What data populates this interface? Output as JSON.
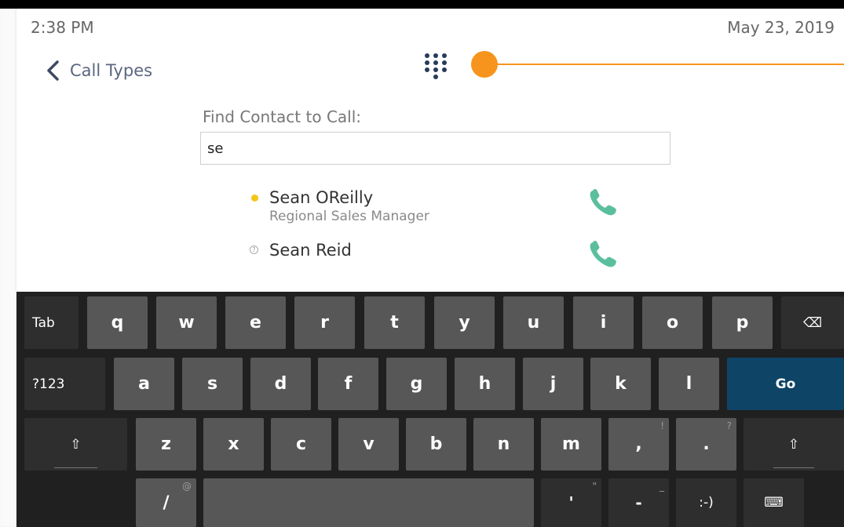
{
  "status": {
    "time": "2:38 PM",
    "date": "May 23, 2019"
  },
  "nav": {
    "back_label": "Call Types",
    "back_icon": "chevron-left-icon",
    "dialpad_icon": "dialpad-icon"
  },
  "search": {
    "label": "Find Contact to Call:",
    "value": "se"
  },
  "contacts": [
    {
      "name": "Sean OReilly",
      "title": "Regional Sales Manager",
      "presence": "available",
      "presence_color": "#f5c518"
    },
    {
      "name": "Sean Reid",
      "title": "",
      "presence": "unknown"
    }
  ],
  "colors": {
    "accent": "#f7941d",
    "call": "#5bbf9f",
    "go_key": "#0e4466"
  },
  "keyboard": {
    "row1": [
      "Tab",
      "q",
      "w",
      "e",
      "r",
      "t",
      "y",
      "u",
      "i",
      "o",
      "p",
      "⌫"
    ],
    "row2": [
      "?123",
      "a",
      "s",
      "d",
      "f",
      "g",
      "h",
      "j",
      "k",
      "l",
      "Go"
    ],
    "row3": [
      "⇧",
      "z",
      "x",
      "c",
      "v",
      "b",
      "n",
      "m",
      ",",
      ".",
      "⇧"
    ],
    "row3_hints": {
      "comma": "!",
      "period": "?"
    },
    "row4": [
      "/",
      "",
      "'",
      "-",
      ":-)",
      "⌨"
    ],
    "row4_hints": {
      "slash": "@",
      "apostrophe": "\"",
      "dash": "_"
    }
  }
}
